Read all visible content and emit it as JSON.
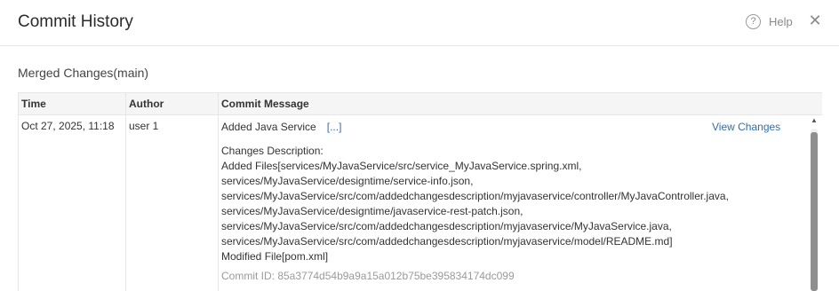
{
  "dialog": {
    "title": "Commit History",
    "help_label": "Help",
    "help_icon": "question-circle-icon",
    "close_icon": "close-icon"
  },
  "section": {
    "title": "Merged Changes(main)"
  },
  "table": {
    "columns": [
      "Time",
      "Author",
      "Commit Message"
    ],
    "rows": [
      {
        "time": "Oct 27, 2025, 11:18",
        "author": "user 1",
        "subject": "Added Java Service",
        "expand_label": "[...]",
        "view_changes_label": "View Changes",
        "description_lines": [
          "Changes Description:",
          "Added Files[services/MyJavaService/src/service_MyJavaService.spring.xml,",
          "services/MyJavaService/designtime/service-info.json,",
          "services/MyJavaService/src/com/addedchangesdescription/myjavaservice/controller/MyJavaController.java,",
          "services/MyJavaService/designtime/javaservice-rest-patch.json,",
          "services/MyJavaService/src/com/addedchangesdescription/myjavaservice/MyJavaService.java,",
          "services/MyJavaService/src/com/addedchangesdescription/myjavaservice/model/README.md]",
          "Modified File[pom.xml]"
        ],
        "commit_id": "Commit ID: 85a3774d54b9a9a15a012b75be395834174dc099"
      }
    ]
  },
  "colors": {
    "link": "#2f6fb3",
    "header_bg": "#f5f5f5",
    "border": "#e6e6e6",
    "muted": "#9a9a9a"
  }
}
